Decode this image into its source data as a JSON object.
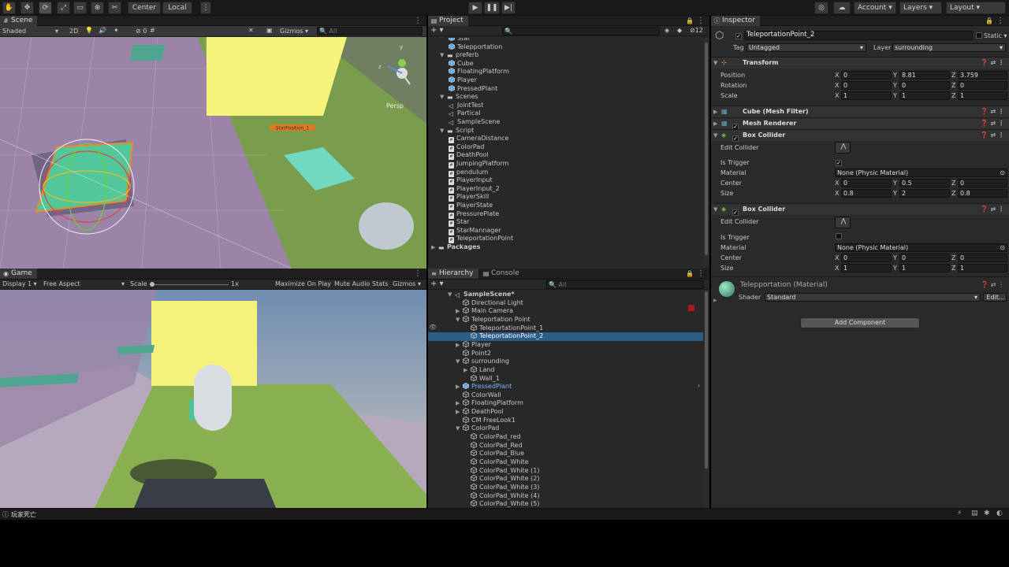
{
  "toolbar": {
    "pivot_label": "Center",
    "space_label": "Local",
    "account_label": "Account",
    "layers_label": "Layers",
    "layout_label": "Layout",
    "tool_icons": [
      "hand-icon",
      "move-icon",
      "rotate-icon",
      "scale-icon",
      "rect-icon",
      "transform-icon",
      "custom-tool-icon"
    ],
    "play_icons": [
      "play-icon",
      "pause-icon",
      "step-icon"
    ]
  },
  "scene": {
    "tab": "Scene",
    "shading": "Shaded",
    "mode_2d": "2D",
    "gizmos": "Gizmos",
    "search_placeholder": "All",
    "persp": "Persp",
    "label_tag": "StarPosition_1",
    "hidden_count": "0"
  },
  "game": {
    "tab": "Game",
    "display": "Display 1",
    "aspect": "Free Aspect",
    "scale_label": "Scale",
    "scale_value": "1x",
    "maximize": "Maximize On Play",
    "mute": "Mute Audio",
    "stats": "Stats",
    "gizmos": "Gizmos"
  },
  "project": {
    "tab": "Project",
    "hidden_count": "12",
    "items": [
      {
        "text": "Star",
        "indent": 2,
        "kind": "prefab"
      },
      {
        "text": "Telepportation",
        "indent": 2,
        "kind": "prefab"
      },
      {
        "text": "preferb",
        "indent": 1,
        "kind": "folder",
        "arrow": "▼"
      },
      {
        "text": "Cube",
        "indent": 2,
        "kind": "prefab"
      },
      {
        "text": "FloatingPlatform",
        "indent": 2,
        "kind": "prefab"
      },
      {
        "text": "Player",
        "indent": 2,
        "kind": "prefab"
      },
      {
        "text": "PressedPlant",
        "indent": 2,
        "kind": "prefab"
      },
      {
        "text": "Scenes",
        "indent": 1,
        "kind": "folder",
        "arrow": "▼"
      },
      {
        "text": "JointTest",
        "indent": 2,
        "kind": "scene"
      },
      {
        "text": "Partical",
        "indent": 2,
        "kind": "scene"
      },
      {
        "text": "SampleScene",
        "indent": 2,
        "kind": "scene"
      },
      {
        "text": "Script",
        "indent": 1,
        "kind": "folder",
        "arrow": "▼"
      },
      {
        "text": "CameraDistance",
        "indent": 2,
        "kind": "script"
      },
      {
        "text": "ColorPad",
        "indent": 2,
        "kind": "script"
      },
      {
        "text": "DeathPool",
        "indent": 2,
        "kind": "script"
      },
      {
        "text": "JumpingPlatform",
        "indent": 2,
        "kind": "script"
      },
      {
        "text": "pendulum",
        "indent": 2,
        "kind": "script"
      },
      {
        "text": "PlayerInput",
        "indent": 2,
        "kind": "script"
      },
      {
        "text": "PlayerInput_2",
        "indent": 2,
        "kind": "script"
      },
      {
        "text": "PlayerSkill",
        "indent": 2,
        "kind": "script"
      },
      {
        "text": "PlayerState",
        "indent": 2,
        "kind": "script"
      },
      {
        "text": "PressurePlate",
        "indent": 2,
        "kind": "script"
      },
      {
        "text": "Star",
        "indent": 2,
        "kind": "script"
      },
      {
        "text": "StarMannager",
        "indent": 2,
        "kind": "script"
      },
      {
        "text": "TeleportationPoint",
        "indent": 2,
        "kind": "script"
      },
      {
        "text": "Packages",
        "indent": 0,
        "kind": "folder",
        "arrow": "▶"
      }
    ]
  },
  "hierarchy": {
    "tab": "Hierarchy",
    "console_tab": "Console",
    "search_placeholder": "All",
    "items": [
      {
        "text": "SampleScene*",
        "indent": 0,
        "arrow": "▼",
        "kind": "scene",
        "bold": true
      },
      {
        "text": "Directional Light",
        "indent": 1,
        "arrow": "",
        "kind": "go"
      },
      {
        "text": "Main Camera",
        "indent": 1,
        "arrow": "▶",
        "kind": "go"
      },
      {
        "text": "Teleportation Point",
        "indent": 1,
        "arrow": "▼",
        "kind": "go"
      },
      {
        "text": "TeleportationPoint_1",
        "indent": 2,
        "arrow": "",
        "kind": "go"
      },
      {
        "text": "TeleportationPoint_2",
        "indent": 2,
        "arrow": "",
        "kind": "go",
        "selected": true
      },
      {
        "text": "Player",
        "indent": 1,
        "arrow": "▶",
        "kind": "go"
      },
      {
        "text": "Point2",
        "indent": 1,
        "arrow": "",
        "kind": "go"
      },
      {
        "text": "surrounding",
        "indent": 1,
        "arrow": "▼",
        "kind": "go"
      },
      {
        "text": "Land",
        "indent": 2,
        "arrow": "▶",
        "kind": "go"
      },
      {
        "text": "Wall_1",
        "indent": 2,
        "arrow": "",
        "kind": "go"
      },
      {
        "text": "PressedPlant",
        "indent": 1,
        "arrow": "▶",
        "kind": "prefab"
      },
      {
        "text": "ColorWall",
        "indent": 1,
        "arrow": "",
        "kind": "go"
      },
      {
        "text": "FloatingPlatform",
        "indent": 1,
        "arrow": "▶",
        "kind": "go"
      },
      {
        "text": "DeathPool",
        "indent": 1,
        "arrow": "▶",
        "kind": "go"
      },
      {
        "text": "CM FreeLook1",
        "indent": 1,
        "arrow": "",
        "kind": "go"
      },
      {
        "text": "ColorPad",
        "indent": 1,
        "arrow": "▼",
        "kind": "go"
      },
      {
        "text": "ColorPad_red",
        "indent": 2,
        "arrow": "",
        "kind": "go"
      },
      {
        "text": "ColorPad_Red",
        "indent": 2,
        "arrow": "",
        "kind": "go"
      },
      {
        "text": "ColorPad_Blue",
        "indent": 2,
        "arrow": "",
        "kind": "go"
      },
      {
        "text": "ColorPad_White",
        "indent": 2,
        "arrow": "",
        "kind": "go"
      },
      {
        "text": "ColorPad_White (1)",
        "indent": 2,
        "arrow": "",
        "kind": "go"
      },
      {
        "text": "ColorPad_White (2)",
        "indent": 2,
        "arrow": "",
        "kind": "go"
      },
      {
        "text": "ColorPad_White (3)",
        "indent": 2,
        "arrow": "",
        "kind": "go"
      },
      {
        "text": "ColorPad_White (4)",
        "indent": 2,
        "arrow": "",
        "kind": "go"
      },
      {
        "text": "ColorPad_White (5)",
        "indent": 2,
        "arrow": "",
        "kind": "go"
      }
    ]
  },
  "inspector": {
    "tab": "Inspector",
    "object_name": "TeleportationPoint_2",
    "static_label": "Static",
    "tag_label": "Tag",
    "tag_value": "Untagged",
    "layer_label": "Layer",
    "layer_value": "surrounding",
    "transform": {
      "title": "Transform",
      "position_label": "Position",
      "pos_x": "0",
      "pos_y": "8.81",
      "pos_z": "3.759",
      "rotation_label": "Rotation",
      "rot_x": "0",
      "rot_y": "0",
      "rot_z": "0",
      "scale_label": "Scale",
      "scl_x": "1",
      "scl_y": "1",
      "scl_z": "1"
    },
    "mesh_filter": "Cube (Mesh Filter)",
    "mesh_renderer": "Mesh Renderer",
    "collider1": {
      "title": "Box Collider",
      "edit": "Edit Collider",
      "trigger_label": "Is Trigger",
      "trigger": "✓",
      "material_label": "Material",
      "material": "None (Physic Material)",
      "center_label": "Center",
      "cx": "0",
      "cy": "0.5",
      "cz": "0",
      "size_label": "Size",
      "sx": "0.8",
      "sy": "2",
      "sz": "0.8"
    },
    "collider2": {
      "title": "Box Collider",
      "edit": "Edit Collider",
      "trigger_label": "Is Trigger",
      "trigger": "",
      "material_label": "Material",
      "material": "None (Physic Material)",
      "center_label": "Center",
      "cx": "0",
      "cy": "0",
      "cz": "0",
      "size_label": "Size",
      "sx": "1",
      "sy": "1",
      "sz": "1"
    },
    "material_name": "Telepportation (Material)",
    "shader_label": "Shader",
    "shader_value": "Standard",
    "edit_button": "Edit...",
    "add_component": "Add Component"
  },
  "status": {
    "message": "玩家死亡"
  },
  "colors": {
    "selection": "#2c5d87",
    "prefab_blue": "#7fb6ff",
    "panel_bg": "#282828"
  }
}
